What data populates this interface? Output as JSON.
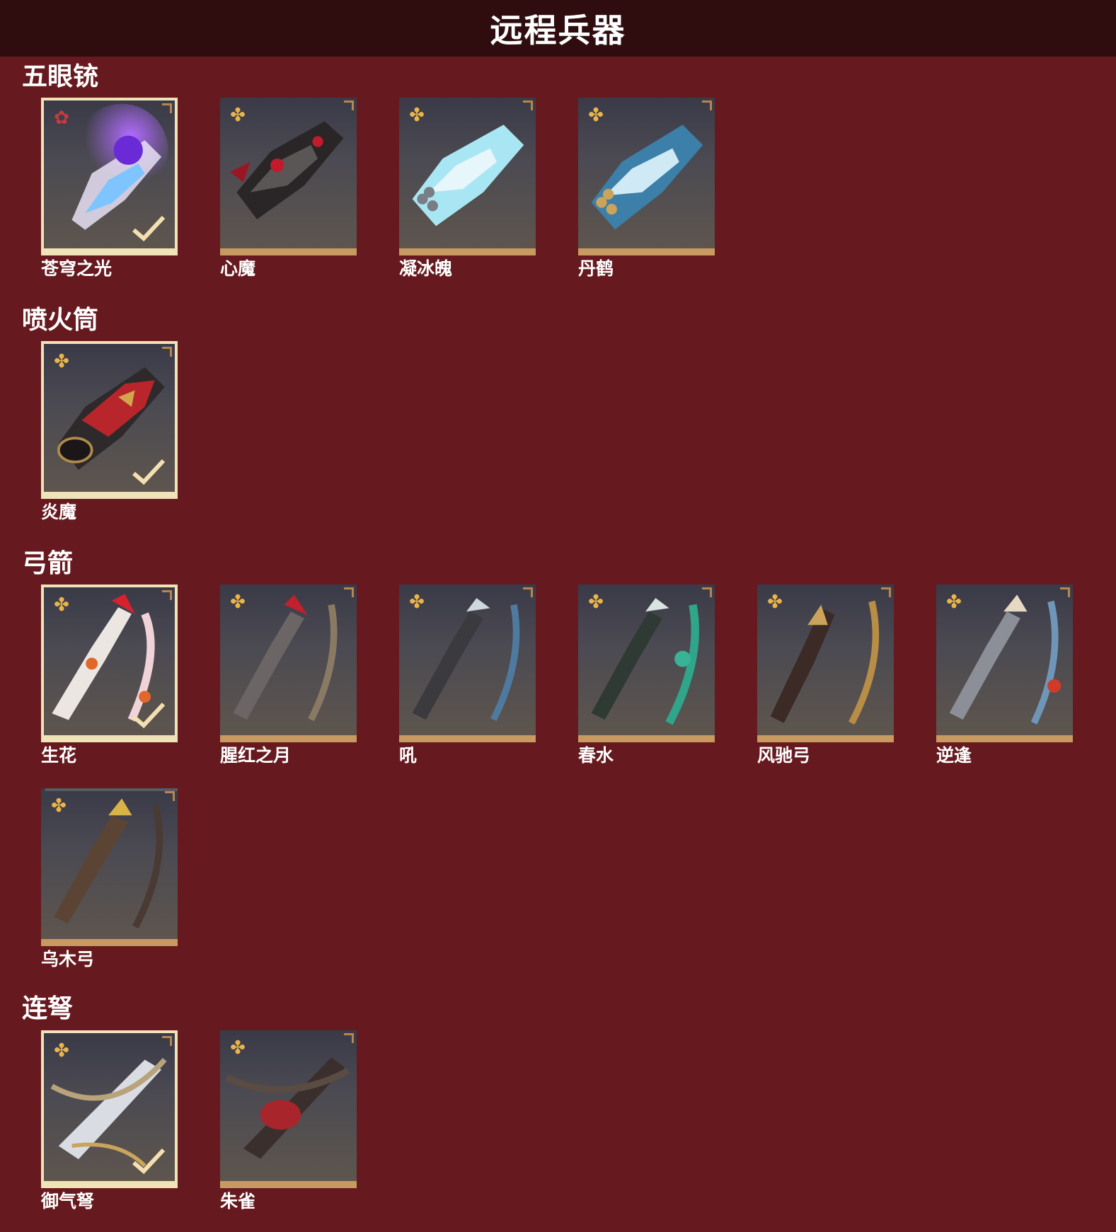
{
  "title": "远程兵器",
  "sections": [
    {
      "name": "五眼铳",
      "items": [
        {
          "label": "苍穹之光",
          "selected": true,
          "rarity_icon": "red-flower-icon",
          "check": true
        },
        {
          "label": "心魔",
          "selected": false,
          "rarity_icon": "gold-flower-icon",
          "check": false
        },
        {
          "label": "凝冰魄",
          "selected": false,
          "rarity_icon": "gold-flower-icon",
          "check": false
        },
        {
          "label": "丹鹤",
          "selected": false,
          "rarity_icon": "gold-flower-icon",
          "check": false
        }
      ]
    },
    {
      "name": "喷火筒",
      "items": [
        {
          "label": "炎魔",
          "selected": true,
          "rarity_icon": "gold-flower-icon",
          "check": true
        }
      ]
    },
    {
      "name": "弓箭",
      "items": [
        {
          "label": "生花",
          "selected": true,
          "rarity_icon": "gold-flower-icon",
          "check": true
        },
        {
          "label": "腥红之月",
          "selected": false,
          "rarity_icon": "gold-flower-icon",
          "check": false
        },
        {
          "label": "吼",
          "selected": false,
          "rarity_icon": "gold-flower-icon",
          "check": false
        },
        {
          "label": "春水",
          "selected": false,
          "rarity_icon": "gold-flower-icon",
          "check": false
        },
        {
          "label": "风驰弓",
          "selected": false,
          "rarity_icon": "gold-flower-icon",
          "check": false
        },
        {
          "label": "逆逢",
          "selected": false,
          "rarity_icon": "gold-flower-icon",
          "check": false
        },
        {
          "label": "乌木弓",
          "selected": false,
          "rarity_icon": "gold-flower-icon",
          "check": false
        }
      ]
    },
    {
      "name": "连弩",
      "items": [
        {
          "label": "御气弩",
          "selected": true,
          "rarity_icon": "gold-flower-icon",
          "check": true
        },
        {
          "label": "朱雀",
          "selected": false,
          "rarity_icon": "gold-flower-icon",
          "check": false
        }
      ]
    }
  ],
  "colors": {
    "background": "#661a1f",
    "header": "#2f0d0f",
    "tile_border": "#c89a62",
    "selected_border": "#f1e3b8",
    "rarity_gold": "#e9b449",
    "rarity_red": "#c93a3e"
  }
}
